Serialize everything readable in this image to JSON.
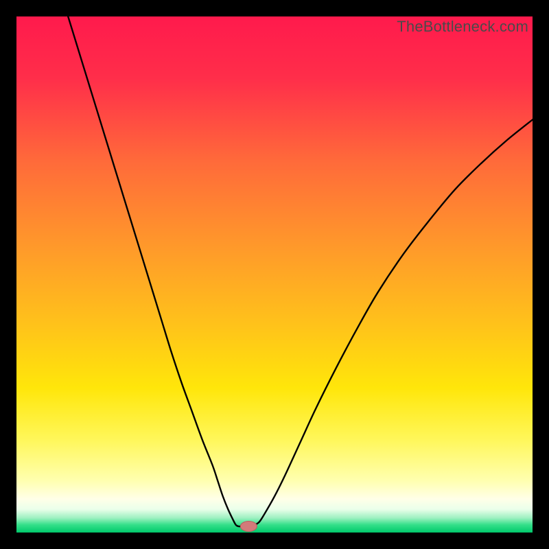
{
  "watermark": "TheBottleneck.com",
  "colors": {
    "bg": "#000000",
    "gradient_stops": [
      {
        "offset": 0.0,
        "color": "#ff1a4c"
      },
      {
        "offset": 0.12,
        "color": "#ff2e4a"
      },
      {
        "offset": 0.28,
        "color": "#ff6a3a"
      },
      {
        "offset": 0.45,
        "color": "#ff9a2a"
      },
      {
        "offset": 0.6,
        "color": "#ffc31a"
      },
      {
        "offset": 0.72,
        "color": "#ffe60a"
      },
      {
        "offset": 0.82,
        "color": "#fff75a"
      },
      {
        "offset": 0.9,
        "color": "#ffffb0"
      },
      {
        "offset": 0.935,
        "color": "#ffffe8"
      },
      {
        "offset": 0.955,
        "color": "#eaffea"
      },
      {
        "offset": 0.972,
        "color": "#9cf0c0"
      },
      {
        "offset": 0.985,
        "color": "#35e08a"
      },
      {
        "offset": 1.0,
        "color": "#00c86b"
      }
    ],
    "curve": "#000000",
    "marker_fill": "#d37a7a",
    "marker_stroke": "#b85f5f"
  },
  "chart_data": {
    "type": "line",
    "title": "",
    "xlabel": "",
    "ylabel": "",
    "xlim": [
      0,
      100
    ],
    "ylim": [
      0,
      100
    ],
    "note": "Decorative bottleneck V-curve; axes are unlabeled percentages.",
    "series": [
      {
        "name": "bottleneck-curve",
        "x_y": [
          [
            10.0,
            100.0
          ],
          [
            12.0,
            93.5
          ],
          [
            14.0,
            87.0
          ],
          [
            16.0,
            80.5
          ],
          [
            18.0,
            74.0
          ],
          [
            20.0,
            67.5
          ],
          [
            22.0,
            61.0
          ],
          [
            24.0,
            54.5
          ],
          [
            26.0,
            48.0
          ],
          [
            28.0,
            41.5
          ],
          [
            30.0,
            35.0
          ],
          [
            32.0,
            29.0
          ],
          [
            34.0,
            23.5
          ],
          [
            36.0,
            18.0
          ],
          [
            38.0,
            13.0
          ],
          [
            39.0,
            10.0
          ],
          [
            40.0,
            7.0
          ],
          [
            41.0,
            4.5
          ],
          [
            42.0,
            2.4
          ],
          [
            42.5,
            1.5
          ],
          [
            43.0,
            1.2
          ],
          [
            44.0,
            1.2
          ],
          [
            45.0,
            1.2
          ],
          [
            45.5,
            1.2
          ],
          [
            46.0,
            1.4
          ],
          [
            47.0,
            2.0
          ],
          [
            48.0,
            3.5
          ],
          [
            50.0,
            7.0
          ],
          [
            52.0,
            11.0
          ],
          [
            55.0,
            17.5
          ],
          [
            58.0,
            24.0
          ],
          [
            62.0,
            32.0
          ],
          [
            66.0,
            39.5
          ],
          [
            70.0,
            46.5
          ],
          [
            75.0,
            54.0
          ],
          [
            80.0,
            60.5
          ],
          [
            85.0,
            66.5
          ],
          [
            90.0,
            71.5
          ],
          [
            95.0,
            76.0
          ],
          [
            100.0,
            80.0
          ]
        ]
      }
    ],
    "marker": {
      "x": 45.0,
      "y": 1.2,
      "rx": 1.6,
      "ry": 1.0
    }
  }
}
